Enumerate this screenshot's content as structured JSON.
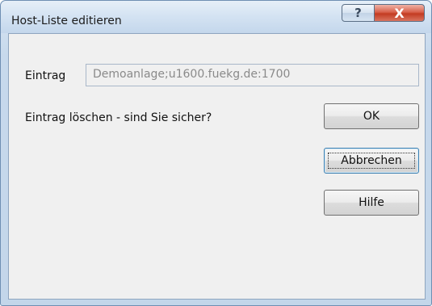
{
  "window": {
    "title": "Host-Liste editieren",
    "help_icon": "question-mark",
    "close_icon": "x-close",
    "help_glyph": "?",
    "close_glyph": "X"
  },
  "form": {
    "entry_label": "Eintrag",
    "entry_value": "Demoanlage;u1600.fuekg.de:1700",
    "question": "Eintrag löschen - sind Sie sicher?"
  },
  "buttons": {
    "ok": "OK",
    "cancel": "Abbrechen",
    "help": "Hilfe"
  },
  "colors": {
    "title_bar": "#c4d7ec",
    "close_button": "#c33b22",
    "dialog_background": "#f0f0f0",
    "focus_border": "#3c7fb1"
  }
}
